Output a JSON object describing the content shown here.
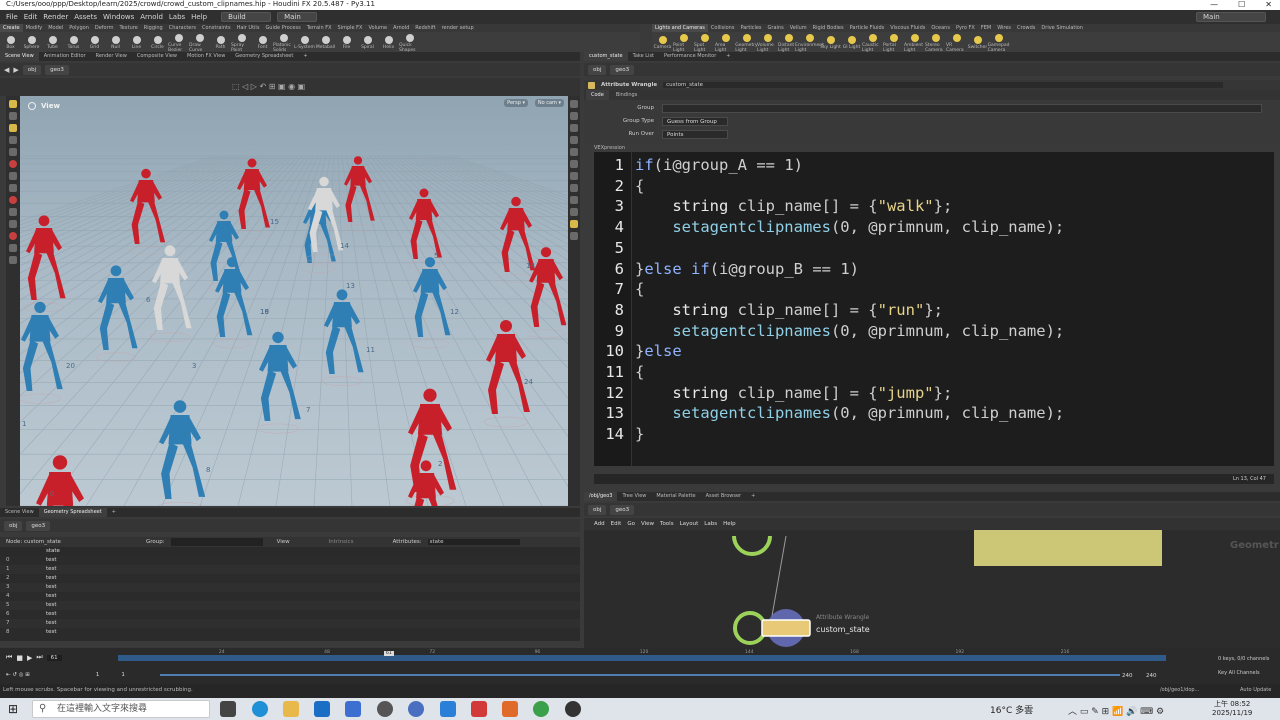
{
  "window": {
    "title": "C:/Users/ooo/ppp/Desktop/learn/2025/crowd/crowd_custom_clipnames.hip - Houdini FX 20.5.487 - Py3.11",
    "min": "—",
    "max": "☐",
    "close": "✕"
  },
  "menu": {
    "items": [
      "File",
      "Edit",
      "Render",
      "Assets",
      "Windows",
      "Arnold",
      "Labs",
      "Help"
    ],
    "desktop_select": "Build",
    "desktop_select2": "Main",
    "right_select": "Main"
  },
  "shelf_tabs_left": [
    "Create",
    "Modify",
    "Model",
    "Polygon",
    "Deform",
    "Texture",
    "Rigging",
    "Characters",
    "Constraints",
    "Hair Utils",
    "Guide Process",
    "Terrain FX",
    "Simple FX",
    "Volume",
    "Arnold",
    "Redshift",
    "render setup"
  ],
  "shelf_tabs_right": [
    "Lights and Cameras",
    "Collisions",
    "Particles",
    "Grains",
    "Vellum",
    "Rigid Bodies",
    "Particle Fluids",
    "Viscous Fluids",
    "Oceans",
    "Pyro FX",
    "FEM",
    "Wires",
    "Crowds",
    "Drive Simulation"
  ],
  "shelf_tools_left": [
    "Box",
    "Sphere",
    "Tube",
    "Torus",
    "Grid",
    "Null",
    "Line",
    "Circle",
    "Curve Bezier",
    "Draw Curve",
    "Path",
    "Spray Paint",
    "Font",
    "Platonic Solids",
    "L-System",
    "Metaball",
    "File",
    "Spiral",
    "Helix",
    "Quick Shapes"
  ],
  "shelf_tools_right": [
    "Camera",
    "Point Light",
    "Spot Light",
    "Area Light",
    "Geometry Light",
    "Volume Light",
    "Distant Light",
    "Environment Light",
    "Sky Light",
    "GI Light",
    "Caustic Light",
    "Portal Light",
    "Ambient Light",
    "Stereo Camera",
    "VR Camera",
    "Switcher",
    "Gamepad Camera"
  ],
  "viewer_tabs": [
    "Scene View",
    "Animation Editor",
    "Render View",
    "Composite View",
    "Motion FX View",
    "Geometry Spreadsheet"
  ],
  "viewer_path": [
    "obj",
    "geo3"
  ],
  "viewport": {
    "label": "View",
    "persp": "Persp ▾",
    "cam": "No cam ▾",
    "agent_labels": [
      "9",
      "15",
      "14",
      "19",
      "5",
      "18",
      "6",
      "16",
      "13",
      "12",
      "11",
      "1",
      "3",
      "20",
      "7",
      "24",
      "8",
      "2",
      "0"
    ]
  },
  "sheet_tabs": [
    "Scene View",
    "Geometry Spreadsheet"
  ],
  "sheet_path": [
    "obj",
    "geo3"
  ],
  "sheet": {
    "node_label": "Node: custom_state",
    "group_label": "Group:",
    "view_label": "View",
    "intrinsics_label": "Intrinsics",
    "attributes_label": "Attributes:",
    "attributes_value": "state",
    "column": "state",
    "rows": [
      {
        "idx": "0",
        "val": "test"
      },
      {
        "idx": "1",
        "val": "test"
      },
      {
        "idx": "2",
        "val": "test"
      },
      {
        "idx": "3",
        "val": "test"
      },
      {
        "idx": "4",
        "val": "test"
      },
      {
        "idx": "5",
        "val": "test"
      },
      {
        "idx": "6",
        "val": "test"
      },
      {
        "idx": "7",
        "val": "test"
      },
      {
        "idx": "8",
        "val": "test"
      }
    ]
  },
  "param_tabs": [
    "custom_state",
    "Take List",
    "Performance Monitor"
  ],
  "param_path": [
    "obj",
    "geo3"
  ],
  "params": {
    "node_type": "Attribute Wrangle",
    "node_name": "custom_state",
    "subtabs": [
      "Code",
      "Bindings"
    ],
    "group_label": "Group",
    "group_type_label": "Group Type",
    "group_type_value": "Guess from Group",
    "run_over_label": "Run Over",
    "run_over_value": "Points",
    "vex_label": "VEXpression",
    "cursor_pos": "Ln 13, Col 47"
  },
  "code": [
    {
      "n": "1",
      "t": "if(i@group_A == 1)"
    },
    {
      "n": "2",
      "t": "{"
    },
    {
      "n": "3",
      "t": "    string clip_name[] = {\"walk\"};"
    },
    {
      "n": "4",
      "t": "    setagentclipnames(0, @primnum, clip_name);"
    },
    {
      "n": "5",
      "t": ""
    },
    {
      "n": "6",
      "t": "}else if(i@group_B == 1)"
    },
    {
      "n": "7",
      "t": "{"
    },
    {
      "n": "8",
      "t": "    string clip_name[] = {\"run\"};"
    },
    {
      "n": "9",
      "t": "    setagentclipnames(0, @primnum, clip_name);"
    },
    {
      "n": "10",
      "t": "}else"
    },
    {
      "n": "11",
      "t": "{"
    },
    {
      "n": "12",
      "t": "    string clip_name[] = {\"jump\"};"
    },
    {
      "n": "13",
      "t": "    setagentclipnames(0, @primnum, clip_name);"
    },
    {
      "n": "14",
      "t": "}"
    }
  ],
  "net_tabs": [
    "/obj/geo3",
    "Tree View",
    "Material Palette",
    "Asset Browser"
  ],
  "net_path": [
    "obj",
    "geo3"
  ],
  "net_menu": [
    "Add",
    "Edit",
    "Go",
    "View",
    "Tools",
    "Layout",
    "Labs",
    "Help"
  ],
  "net": {
    "node_type": "Attribute Wrangle",
    "node_name": "custom_state",
    "watermark": "Geometr"
  },
  "timeline": {
    "frame": "61",
    "start": "1",
    "start2": "1",
    "end": "240",
    "end2": "240",
    "ticks": [
      "24",
      "48",
      "72",
      "96",
      "120",
      "144",
      "168",
      "192",
      "216"
    ],
    "current_marker": "61",
    "keys": "0 keys, 0/0 channels",
    "key_all": "Key All Channels",
    "auto_update": "Auto Update",
    "path": "/obj/geo1/dop..."
  },
  "status": "Left mouse scrubs. Spacebar for viewing and unrestricted scrubbing.",
  "taskbar": {
    "search_placeholder": "在這裡輸入文字來搜尋",
    "weather": "16°C 多雲",
    "time": "上午 08:52",
    "date": "2025/11/19"
  },
  "colors": {
    "red_agent": "#c8202a",
    "blue_agent": "#2f7fb5",
    "white_agent": "#d8d8d8",
    "code_bg": "#1d1d1d",
    "timeline_blue": "#2f5a8a",
    "note_yellow": "#cbc776"
  }
}
